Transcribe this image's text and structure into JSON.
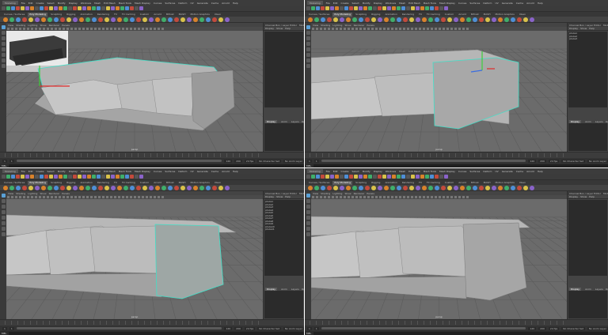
{
  "menubar": {
    "workspace": "Modeling",
    "items": [
      "File",
      "Edit",
      "Create",
      "Select",
      "Modify",
      "Display",
      "Windows",
      "Mesh",
      "Edit Mesh",
      "Mesh Tools",
      "Mesh Display",
      "Curves",
      "Surfaces",
      "Deform",
      "UV",
      "Generate",
      "Cache",
      "Arnold",
      "Help"
    ]
  },
  "shelf_tabs": [
    "Curves / Surfaces",
    "Poly Modeling",
    "Sculpting",
    "Rigging",
    "Animation",
    "Rendering",
    "FX",
    "FX Caching",
    "Custom",
    "Arnold",
    "Bifrost",
    "MASH",
    "Motion Graphics",
    "XGen"
  ],
  "active_shelf_tab": 1,
  "viewport_menu": [
    "View",
    "Shading",
    "Lighting",
    "Show",
    "Renderer",
    "Panels"
  ],
  "camera_label": "persp",
  "outliner_header": [
    "Display",
    "Show",
    "Help"
  ],
  "outliner_tabs": [
    "Channel Box / Layer Editor",
    "Modeling Toolkit",
    "Attribute Editor"
  ],
  "layers": {
    "tabs": [
      "Display",
      "Anim"
    ],
    "menus": [
      "Layers",
      "Options",
      "Help"
    ]
  },
  "range": {
    "start": "1",
    "start_inner": "1",
    "end_inner": "120",
    "end": "200",
    "fps": "24 fps",
    "char_set": "No Character Set",
    "anim_layer": "No Anim Layer"
  },
  "command": {
    "label": "MEL"
  },
  "panels": [
    {
      "outliner_rows": []
    },
    {
      "outliner_rows": [
        "pCube1",
        "pCube2",
        "pCube3"
      ]
    },
    {
      "outliner_rows": [
        "pCube1",
        "pCube2",
        "pCube3",
        "pCube4",
        "pCube5",
        "pCube6",
        "pCube7",
        "pCube8",
        "pCube9",
        "pCube10",
        "pCube11"
      ]
    },
    {
      "outliner_rows": []
    }
  ],
  "colors": {
    "viewport_bg": "#6b6b6b",
    "selection_highlight": "#40e0c8",
    "shelf_icon_orange": "#d9822b",
    "shelf_icon_green": "#3fae6a",
    "shelf_icon_blue": "#4e8fd6",
    "shelf_icon_red": "#c34a3c"
  }
}
